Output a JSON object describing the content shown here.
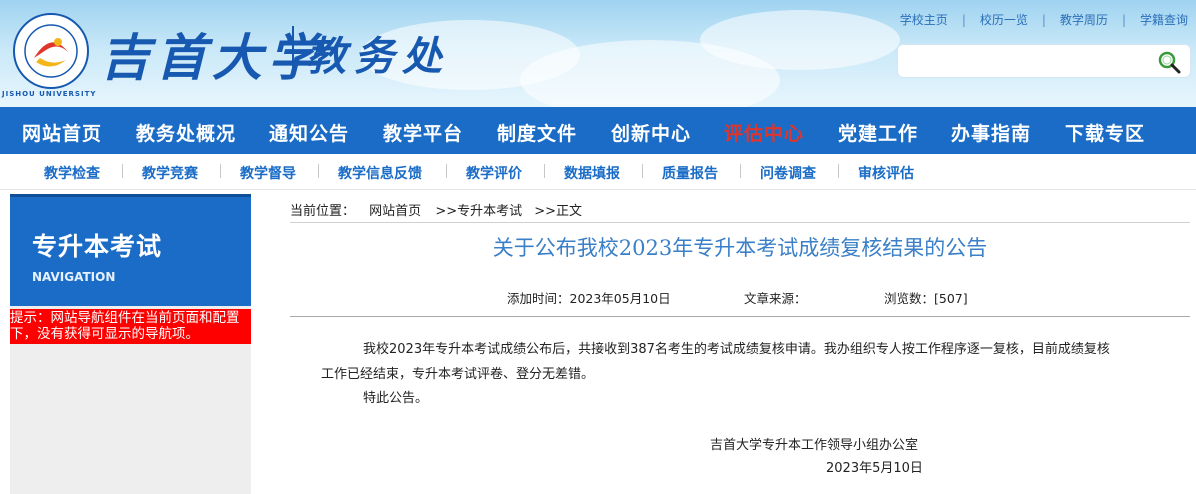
{
  "header": {
    "school_name": "吉首大学",
    "department": "教务处",
    "logo_ring_text": "JISHOU UNIVERSITY",
    "top_links": [
      "学校主页",
      "校历一览",
      "教学周历",
      "学籍查询"
    ],
    "search": {
      "placeholder": ""
    }
  },
  "main_nav": [
    {
      "label": "网站首页",
      "active": false
    },
    {
      "label": "教务处概况",
      "active": false
    },
    {
      "label": "通知公告",
      "active": false
    },
    {
      "label": "教学平台",
      "active": false
    },
    {
      "label": "制度文件",
      "active": false
    },
    {
      "label": "创新中心",
      "active": false
    },
    {
      "label": "评估中心",
      "active": true
    },
    {
      "label": "党建工作",
      "active": false
    },
    {
      "label": "办事指南",
      "active": false
    },
    {
      "label": "下载专区",
      "active": false
    }
  ],
  "sub_nav": [
    "教学检查",
    "教学竞赛",
    "教学督导",
    "教学信息反馈",
    "教学评价",
    "数据填报",
    "质量报告",
    "问卷调查",
    "审核评估"
  ],
  "sidebar": {
    "title": "专升本考试",
    "nav_label": "NAVIGATION",
    "notice": "提示：网站导航组件在当前页面和配置下，没有获得可显示的导航项。"
  },
  "breadcrumb": {
    "prefix": "当前位置：",
    "home": "网站首页",
    "section": ">>专升本考试",
    "current": ">>正文"
  },
  "article": {
    "title": "关于公布我校2023年专升本考试成绩复核结果的公告",
    "added_label": "添加时间：2023年05月10日",
    "source_label": "文章来源：",
    "views_label": "浏览数：[507]",
    "paragraph1_line1": "我校2023年专升本考试成绩公布后，共接收到387名考生的考试成绩复核申请。我办组织专人按工作程序逐一复核，目前成绩复核",
    "paragraph1_line2": "工作已经结束，专升本考试评卷、登分无差错。",
    "paragraph2": "特此公告。",
    "signature": "吉首大学专升本工作领导小组办公室",
    "date": "2023年5月10日"
  },
  "colors": {
    "nav_blue": "#1a6cc7",
    "active_red": "#e0352b",
    "title_blue": "#3a7fc8",
    "notice_red": "#ff0000"
  }
}
